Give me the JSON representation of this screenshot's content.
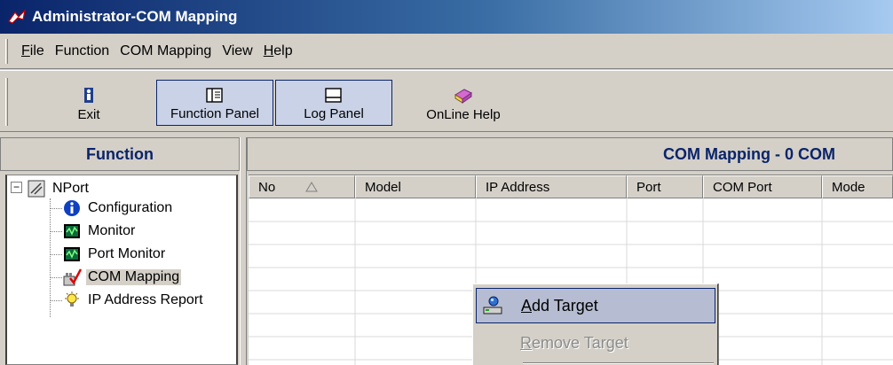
{
  "window": {
    "title": "Administrator-COM Mapping"
  },
  "menu": [
    {
      "label": "File",
      "underline": "F"
    },
    {
      "label": "Function",
      "underline": ""
    },
    {
      "label": "COM Mapping",
      "underline": ""
    },
    {
      "label": "View",
      "underline": ""
    },
    {
      "label": "Help",
      "underline": "H"
    }
  ],
  "toolbar": {
    "exit": "Exit",
    "function_panel": "Function Panel",
    "log_panel": "Log Panel",
    "online_help": "OnLine Help"
  },
  "left_panel": {
    "header": "Function",
    "root": "NPort",
    "items": [
      {
        "label": "Configuration",
        "icon": "info-icon"
      },
      {
        "label": "Monitor",
        "icon": "monitor-icon"
      },
      {
        "label": "Port Monitor",
        "icon": "port-monitor-icon"
      },
      {
        "label": "COM Mapping",
        "icon": "com-mapping-icon",
        "selected": true
      },
      {
        "label": "IP Address Report",
        "icon": "ip-report-icon"
      }
    ]
  },
  "right_panel": {
    "header": "COM Mapping - 0 COM",
    "columns": [
      "No",
      "Model",
      "IP Address",
      "Port",
      "COM Port",
      "Mode"
    ],
    "rows": []
  },
  "context_menu": {
    "add_target": "Add Target",
    "remove_target": "Remove Target"
  },
  "colors": {
    "header_text": "#0a246a",
    "title_gradient_start": "#0a246a",
    "menu_hover": "#b6bdd2"
  }
}
